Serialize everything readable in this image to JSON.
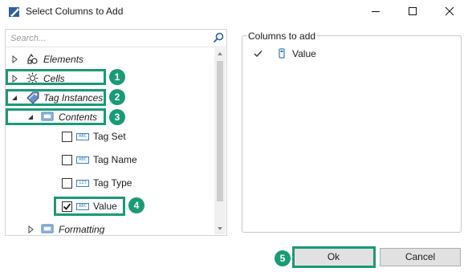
{
  "window": {
    "title": "Select Columns to Add"
  },
  "search": {
    "placeholder": "Search..."
  },
  "tree": {
    "elements": "Elements",
    "cells": "Cells",
    "tag_instances": "Tag Instances",
    "contents": "Contents",
    "tag_set": "Tag Set",
    "tag_name": "Tag Name",
    "tag_type": "Tag Type",
    "value": "Value",
    "formatting": "Formatting"
  },
  "right": {
    "group_title": "Columns to add",
    "selected_column": "Value"
  },
  "buttons": {
    "ok": "Ok",
    "cancel": "Cancel"
  },
  "badges": [
    "1",
    "2",
    "3",
    "4",
    "5"
  ],
  "icons": {
    "abc": "ABC",
    "num": "123"
  },
  "colors": {
    "highlight": "#1a9a76",
    "icon_blue": "#3f7fbf"
  }
}
